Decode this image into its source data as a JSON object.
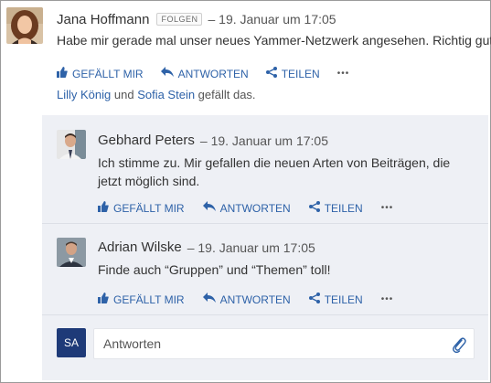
{
  "post": {
    "author": "Jana Hoffmann",
    "follow_label": "FOLGEN",
    "timestamp": "– 19. Januar um 17:05",
    "message": "Habe mir gerade mal unser neues Yammer-Netzwerk angesehen. Richtig gut!",
    "actions": {
      "like": "GEFÄLLT MIR",
      "reply": "ANTWORTEN",
      "share": "TEILEN",
      "more": "•••"
    },
    "likes": {
      "user1": "Lilly König",
      "conj": " und ",
      "user2": "Sofia Stein",
      "suffix": " gefällt das."
    }
  },
  "replies": [
    {
      "author": "Gebhard Peters",
      "timestamp": "– 19. Januar um 17:05",
      "message": "Ich stimme zu. Mir gefallen die neuen Arten von Beiträgen, die jetzt möglich sind.",
      "actions": {
        "like": "GEFÄLLT MIR",
        "reply": "ANTWORTEN",
        "share": "TEILEN",
        "more": "•••"
      }
    },
    {
      "author": "Adrian Wilske",
      "timestamp": "– 19. Januar um 17:05",
      "message": "Finde auch “Gruppen” und “Themen” toll!",
      "actions": {
        "like": "GEFÄLLT MIR",
        "reply": "ANTWORTEN",
        "share": "TEILEN",
        "more": "•••"
      }
    }
  ],
  "composer": {
    "initials": "SA",
    "placeholder": "Antworten"
  },
  "colors": {
    "link": "#2e62a8",
    "thread_bg": "#eef0f5",
    "composer_avatar": "#1e3a78"
  },
  "icons": [
    "thumbs-up-icon",
    "reply-arrow-icon",
    "share-icon",
    "more-icon",
    "paperclip-icon"
  ]
}
